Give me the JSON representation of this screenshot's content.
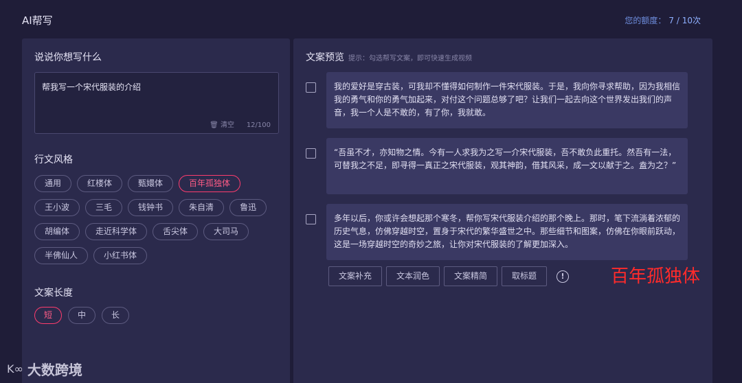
{
  "header": {
    "title": "AI帮写",
    "quota_label": "您的额度：",
    "quota_value": "7 / 10次"
  },
  "input_section": {
    "title": "说说你想写什么",
    "value": "帮我写一个宋代服装的介绍",
    "clear_label": "清空",
    "char_count": "12/100"
  },
  "style_section": {
    "title": "行文风格",
    "options": [
      "通用",
      "红楼体",
      "甄嬛体",
      "百年孤独体",
      "王小波",
      "三毛",
      "钱钟书",
      "朱自清",
      "鲁迅",
      "胡编体",
      "走近科学体",
      "舌尖体",
      "大司马",
      "半佛仙人",
      "小红书体"
    ],
    "selected": "百年孤独体"
  },
  "length_section": {
    "title": "文案长度",
    "options": [
      "短",
      "中",
      "长"
    ],
    "selected": "短"
  },
  "preview": {
    "title": "文案预览",
    "hint": "提示：勾选帮写文案，即可快速生成视频",
    "options": [
      {
        "text": "我的爱好是穿古装，可我却不懂得如何制作一件宋代服装。于是，我向你寻求帮助，因为我相信我的勇气和你的勇气加起来，对付这个问题总够了吧？让我们一起去向这个世界发出我们的声音，我一个人是不敢的，有了你，我就敢。"
      },
      {
        "text": "“吾虽不才，亦知物之情。今有一人求我为之写一介宋代服装，吾不敢负此重托。然吾有一法，可替我之不足，即寻得一真正之宋代服装，观其神韵，借其风采，成一文以献于之。盍为之？”"
      },
      {
        "text": "多年以后，你或许会想起那个寒冬，帮你写宋代服装介绍的那个晚上。那时，笔下流淌着浓郁的历史气息，仿佛穿越时空，置身于宋代的繁华盛世之中。那些细节和图案，仿佛在你眼前跃动，这是一场穿越时空的奇妙之旅，让你对宋代服装的了解更加深入。"
      }
    ],
    "actions": [
      "文案补充",
      "文本润色",
      "文案精简",
      "取标题"
    ]
  },
  "annotation": "百年孤独体",
  "watermark": "大数跨境",
  "colors": {
    "background": "#1f1d38",
    "panel": "#2b2a4c",
    "card": "#3a3963",
    "accent": "#ff3c6e",
    "quota": "#6f8fe0",
    "annotation": "#ff2b2b"
  }
}
